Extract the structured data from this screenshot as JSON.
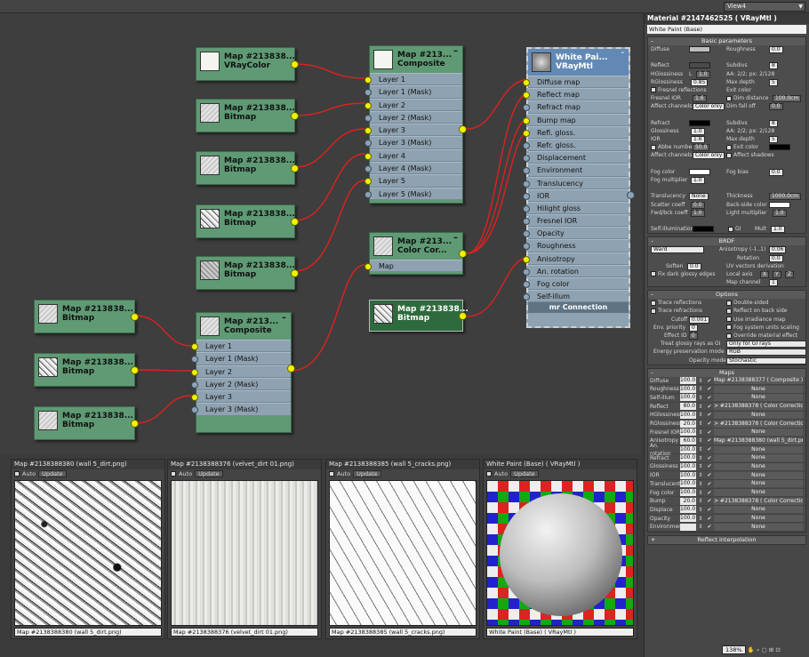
{
  "view_select": "View4",
  "nodes": {
    "vraycolor": {
      "title1": "Map #213838...",
      "title2": "VRayColor"
    },
    "bitmap_a": {
      "title1": "Map #213838...",
      "title2": "Bitmap"
    },
    "bitmap_b": {
      "title1": "Map #213838...",
      "title2": "Bitmap"
    },
    "bitmap_c": {
      "title1": "Map #213838...",
      "title2": "Bitmap"
    },
    "bitmap_d": {
      "title1": "Map #213838...",
      "title2": "Bitmap"
    },
    "composite1": {
      "title1": "Map #213...",
      "title2": "Composite",
      "slots": [
        "Layer 1",
        "Layer 1 (Mask)",
        "Layer 2",
        "Layer 2 (Mask)",
        "Layer 3",
        "Layer 3 (Mask)",
        "Layer 4",
        "Layer 4 (Mask)",
        "Layer 5",
        "Layer 5 (Mask)"
      ]
    },
    "colorcor": {
      "title1": "Map #213...",
      "title2": "Color Cor...",
      "slots": [
        "Map"
      ]
    },
    "bitmap_sel": {
      "title1": "Map #213838...",
      "title2": "Bitmap"
    },
    "bitmap_e": {
      "title1": "Map #213838...",
      "title2": "Bitmap"
    },
    "bitmap_f": {
      "title1": "Map #213838...",
      "title2": "Bitmap"
    },
    "bitmap_g": {
      "title1": "Map #213838...",
      "title2": "Bitmap"
    },
    "composite2": {
      "title1": "Map #213...",
      "title2": "Composite",
      "slots": [
        "Layer 1",
        "Layer 1 (Mask)",
        "Layer 2",
        "Layer 2 (Mask)",
        "Layer 3",
        "Layer 3 (Mask)"
      ]
    },
    "material": {
      "title1": "White Pai...",
      "title2": "VRayMtl",
      "slots": [
        "Diffuse map",
        "Reflect map",
        "Refract map",
        "Bump map",
        "Refl. gloss.",
        "Refr. gloss.",
        "Displacement",
        "Environment",
        "Translucency",
        "IOR",
        "Hilight gloss",
        "Fresnel IOR",
        "Opacity",
        "Roughness",
        "Anisotropy",
        "An. rotation",
        "Fog color",
        "Self-illum"
      ],
      "footer": "mr Connection"
    }
  },
  "previews": [
    {
      "title": "Map #2138388380 (wall 5_dirt.png)",
      "auto": "Auto",
      "update": "Update",
      "select": "Map #2138388380 (wall 5_dirt.png)"
    },
    {
      "title": "Map #2138388376 (velvet_dirt 01.png)",
      "auto": "Auto",
      "update": "Update",
      "select": "Map #2138388376 (velvet_dirt 01.png)"
    },
    {
      "title": "Map #2138388385 (wall 5_cracks.png)",
      "auto": "Auto",
      "update": "Update",
      "select": "Map #2138388385 (wall 5_cracks.png)"
    },
    {
      "title": "White Paint (Base)   ( VRayMtl )",
      "auto": "Auto",
      "update": "Update",
      "select": "White Paint (Base)   ( VRayMtl )"
    }
  ],
  "panel": {
    "title": "Material #2147462525  ( VRayMtl )",
    "name": "White Paint (Base)",
    "basic_header": "Basic parameters",
    "diffuse": "Diffuse",
    "roughness": "Roughness",
    "roughness_val": "0.0",
    "reflect": "Reflect",
    "subdivs": "Subdivs",
    "subdivs_val": "8",
    "hglossiness": "HGlossiness",
    "hgloss_l": "L",
    "hgloss_val": "1.0",
    "aa": "AA: 2/2; px: 2/128",
    "rglossiness": "RGlossiness",
    "rgloss_val": "0.85",
    "max_depth": "Max depth",
    "max_depth_val": "5",
    "fresnel_refl": "Fresnel reflections",
    "exit_color": "Exit color",
    "fresnel_ior": "Fresnel IOR",
    "fresnel_ior_val": "1.6",
    "dim_distance": "Dim distance",
    "dim_distance_val": "100.0cm",
    "affect_channels": "Affect channels",
    "affect_val": "Color only",
    "dim_falloff": "Dim fall off",
    "dim_falloff_val": "0.0",
    "refract": "Refract",
    "refr_subdivs_val": "8",
    "glossiness": "Glossiness",
    "gloss_val": "1.0",
    "aa2": "AA: 2/2; px: 2/128",
    "ior": "IOR",
    "ior_val": "1.6",
    "max_depth2_val": "5",
    "abbe": "Abbe number",
    "abbe_val": "50.0",
    "exit_color2": "Exit color",
    "affect_channels2": "Affect channels",
    "affect_val2": "Color only",
    "affect_shadows": "Affect shadows",
    "fog_color": "Fog color",
    "fog_bias": "Fog bias",
    "fog_bias_val": "0.0",
    "fog_mult": "Fog multiplier",
    "fog_mult_val": "1.0",
    "translucency": "Translucency",
    "transl_val": "None",
    "thickness": "Thickness",
    "thickness_val": "1000.0cm",
    "scatter": "Scatter coeff",
    "scatter_val": "0.0",
    "backside": "Back-side color",
    "fwdbck": "Fwd/bck coeff",
    "fwdbck_val": "1.0",
    "light_mult": "Light multiplier",
    "light_mult_val": "1.0",
    "self_illum": "Self-illumination",
    "gi": "GI",
    "mult": "Mult",
    "mult_val": "1.0",
    "brdf_header": "BRDF",
    "brdf_type": "Ward",
    "anisotropy": "Anisotropy (-1..1)",
    "aniso_val": "0.06",
    "rotation": "Rotation",
    "rotation_val": "0.0",
    "soften": "Soften",
    "soften_val": "0.0",
    "uv_deriv": "UV vectors derivation",
    "local_axis": "Local axis",
    "axes": [
      "X",
      "Y",
      "Z"
    ],
    "fix_dark": "Fix dark glossy edges",
    "map_channel": "Map channel",
    "map_channel_val": "1",
    "options_header": "Options",
    "trace_refl": "Trace reflections",
    "double_sided": "Double-sided",
    "trace_refr": "Trace refractions",
    "reflect_back": "Reflect on back side",
    "cutoff": "Cutoff",
    "cutoff_val": "0.001",
    "use_irr": "Use irradiance map",
    "env_priority": "Env. priority",
    "env_priority_val": "0",
    "fog_units": "Fog system units scaling",
    "effect_id": "Effect ID",
    "effect_id_val": "0",
    "override": "Override material effect",
    "treat_glossy": "Treat glossy rays as GI",
    "treat_glossy_val": "Only for GI rays",
    "energy": "Energy preservation mode",
    "energy_val": "RGB",
    "opacity_mode": "Opacity mode",
    "opacity_mode_val": "Stochastic",
    "maps_header": "Maps",
    "maps": [
      {
        "name": "Diffuse",
        "val": "100.0",
        "map": "Map #2138388377  ( Composite )"
      },
      {
        "name": "Roughness",
        "val": "100.0",
        "map": "None"
      },
      {
        "name": "Self-illum",
        "val": "100.0",
        "map": "None"
      },
      {
        "name": "Reflect",
        "val": "80.0",
        "map": "> #2138388378  ( Color Correction )"
      },
      {
        "name": "HGlossiness",
        "val": "100.0",
        "map": "None"
      },
      {
        "name": "RGlossiness",
        "val": "20.0",
        "map": "> #2138388378  ( Color Correction )"
      },
      {
        "name": "Fresnel IOR",
        "val": "100.0",
        "map": "None"
      },
      {
        "name": "Anisotropy",
        "val": "60.0",
        "map": "Map #2138388380 (wall 5_dirt.png)"
      },
      {
        "name": "An. rotation",
        "val": "100.0",
        "map": "None"
      },
      {
        "name": "Refract",
        "val": "100.0",
        "map": "None"
      },
      {
        "name": "Glossiness",
        "val": "100.0",
        "map": "None"
      },
      {
        "name": "IOR",
        "val": "100.0",
        "map": "None"
      },
      {
        "name": "Translucent",
        "val": "100.0",
        "map": "None"
      },
      {
        "name": "Fog color",
        "val": "100.0",
        "map": "None"
      },
      {
        "name": "Bump",
        "val": "20.0",
        "map": "> #2138388378  ( Color Correction )"
      },
      {
        "name": "Displace",
        "val": "100.0",
        "map": "None"
      },
      {
        "name": "Opacity",
        "val": "100.0",
        "map": "None"
      },
      {
        "name": "Environment",
        "val": "",
        "map": "None"
      }
    ],
    "reflect_interp": "Reflect interpolation"
  },
  "status": {
    "zoom": "138%"
  },
  "colors": {
    "node_green": "#5f9a74",
    "slot_blue": "#8fa2b1",
    "material_header": "#6289b5",
    "wire_red": "#e02020",
    "pin_yellow": "#f2f200"
  }
}
